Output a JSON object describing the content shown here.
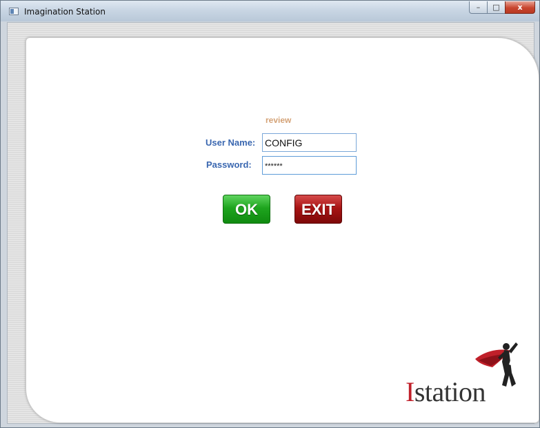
{
  "window": {
    "title": "Imagination Station",
    "controls": {
      "minimize": "–",
      "maximize": "□",
      "close": "x"
    }
  },
  "login": {
    "header": "review",
    "username_label": "User Name:",
    "username_value": "CONFIG",
    "password_label": "Password:",
    "password_value": "******"
  },
  "buttons": {
    "ok_label": "OK",
    "exit_label": "EXIT"
  },
  "logo": {
    "initial": "I",
    "rest": "station"
  },
  "colors": {
    "label": "#3a67b0",
    "header": "#d4a276",
    "ok": "#1ea51e",
    "exit": "#a81414",
    "logo_accent": "#c0202a"
  }
}
